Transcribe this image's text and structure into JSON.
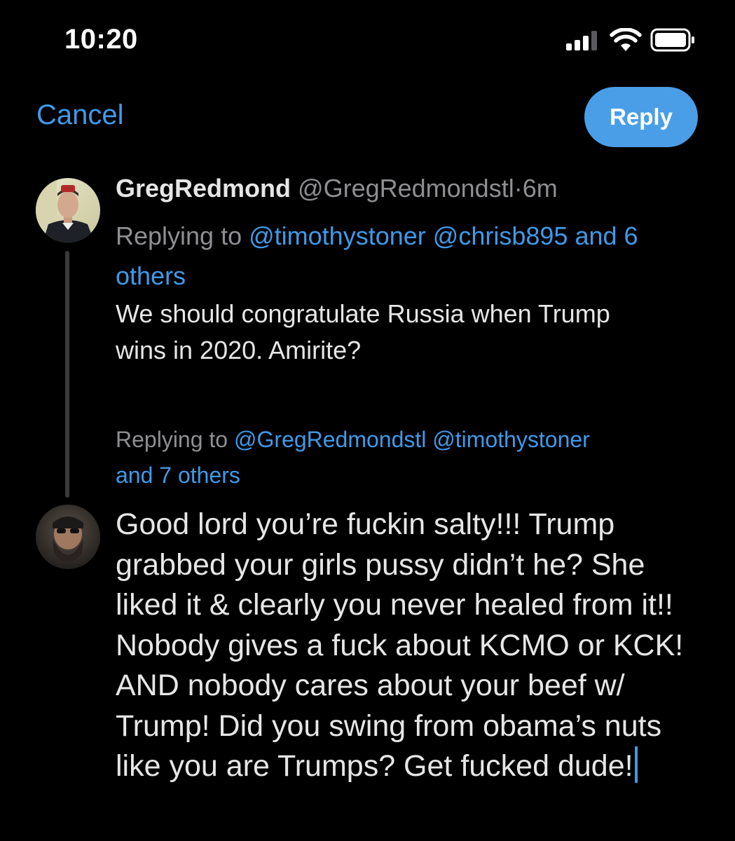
{
  "status_bar": {
    "time": "10:20",
    "icons": [
      "signal-icon",
      "wifi-icon",
      "battery-icon"
    ]
  },
  "nav": {
    "cancel_label": "Cancel",
    "reply_label": "Reply"
  },
  "original_tweet": {
    "display_name": "GregRedmond",
    "handle": "@GregRedmondstl",
    "separator": "·",
    "timestamp": "6m",
    "replying_prefix": "Replying to",
    "mentions": [
      "@timothystoner",
      "@chrisb895"
    ],
    "others": "and 6 others",
    "body_line1": "We should congratulate Russia when Trump",
    "body_line2": "wins in 2020. Amirite?"
  },
  "compose": {
    "replying_prefix": "Replying to",
    "mentions": [
      "@GregRedmondstl",
      "@timothystoner"
    ],
    "others": "and 7 others",
    "text": "Good lord you’re fuckin salty!!! Trump grabbed your girls pussy didn’t he? She liked it & clearly you never healed from it!! Nobody gives a fuck about KCMO or KCK! AND nobody cares about your beef w/ Trump! Did you swing from obama’s nuts like you are Trumps? Get fucked dude!"
  },
  "colors": {
    "background": "#000000",
    "accent": "#3f9ae8",
    "reply_button": "#4a9ee8",
    "secondary_text": "#8e8e93",
    "primary_text": "#e6e6e6",
    "thread_line": "#3a3a3c"
  }
}
